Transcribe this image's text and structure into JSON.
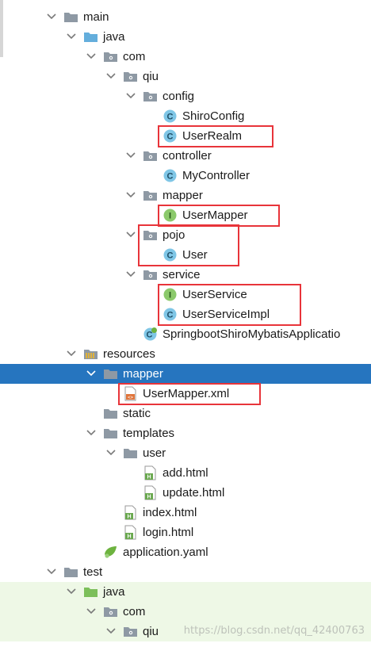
{
  "tree": [
    {
      "id": "main",
      "label": "main",
      "depth": 0,
      "kind": "folder-gray",
      "arrow": "expanded"
    },
    {
      "id": "java",
      "label": "java",
      "depth": 1,
      "kind": "folder-blue",
      "arrow": "expanded"
    },
    {
      "id": "com",
      "label": "com",
      "depth": 2,
      "kind": "package",
      "arrow": "expanded"
    },
    {
      "id": "qiu",
      "label": "qiu",
      "depth": 3,
      "kind": "package",
      "arrow": "expanded"
    },
    {
      "id": "config",
      "label": "config",
      "depth": 4,
      "kind": "package",
      "arrow": "expanded"
    },
    {
      "id": "shiroconfig",
      "label": "ShiroConfig",
      "depth": 5,
      "kind": "class"
    },
    {
      "id": "userrealm",
      "label": "UserRealm",
      "depth": 5,
      "kind": "class"
    },
    {
      "id": "controller",
      "label": "controller",
      "depth": 4,
      "kind": "package",
      "arrow": "expanded"
    },
    {
      "id": "mycontroller",
      "label": "MyController",
      "depth": 5,
      "kind": "class"
    },
    {
      "id": "mapper-pkg",
      "label": "mapper",
      "depth": 4,
      "kind": "package",
      "arrow": "expanded"
    },
    {
      "id": "usermapper",
      "label": "UserMapper",
      "depth": 5,
      "kind": "interface"
    },
    {
      "id": "pojo",
      "label": "pojo",
      "depth": 4,
      "kind": "package",
      "arrow": "expanded"
    },
    {
      "id": "user",
      "label": "User",
      "depth": 5,
      "kind": "class"
    },
    {
      "id": "service",
      "label": "service",
      "depth": 4,
      "kind": "package",
      "arrow": "expanded"
    },
    {
      "id": "userservice",
      "label": "UserService",
      "depth": 5,
      "kind": "interface"
    },
    {
      "id": "userserviceimpl",
      "label": "UserServiceImpl",
      "depth": 5,
      "kind": "class"
    },
    {
      "id": "springbootapp",
      "label": "SpringbootShiroMybatisApplicatio",
      "depth": 4,
      "kind": "spring-class"
    },
    {
      "id": "resources",
      "label": "resources",
      "depth": 1,
      "kind": "folder-resources",
      "arrow": "expanded"
    },
    {
      "id": "mapper-res",
      "label": "mapper",
      "depth": 2,
      "kind": "folder-gray",
      "arrow": "expanded",
      "selected": true
    },
    {
      "id": "usermapper-xml",
      "label": "UserMapper.xml",
      "depth": 3,
      "kind": "xml"
    },
    {
      "id": "static",
      "label": "static",
      "depth": 2,
      "kind": "folder-gray"
    },
    {
      "id": "templates",
      "label": "templates",
      "depth": 2,
      "kind": "folder-gray",
      "arrow": "expanded"
    },
    {
      "id": "user-dir",
      "label": "user",
      "depth": 3,
      "kind": "folder-gray",
      "arrow": "expanded"
    },
    {
      "id": "add-html",
      "label": "add.html",
      "depth": 4,
      "kind": "html"
    },
    {
      "id": "update-html",
      "label": "update.html",
      "depth": 4,
      "kind": "html"
    },
    {
      "id": "index-html",
      "label": "index.html",
      "depth": 3,
      "kind": "html"
    },
    {
      "id": "login-html",
      "label": "login.html",
      "depth": 3,
      "kind": "html"
    },
    {
      "id": "application-yaml",
      "label": "application.yaml",
      "depth": 2,
      "kind": "yaml"
    },
    {
      "id": "test",
      "label": "test",
      "depth": 0,
      "kind": "folder-gray",
      "arrow": "expanded"
    },
    {
      "id": "test-java",
      "label": "java",
      "depth": 1,
      "kind": "folder-green",
      "arrow": "expanded",
      "test_bg": true
    },
    {
      "id": "test-com",
      "label": "com",
      "depth": 2,
      "kind": "package",
      "arrow": "expanded",
      "test_bg": true
    },
    {
      "id": "test-qiu",
      "label": "qiu",
      "depth": 3,
      "kind": "package",
      "arrow": "expanded",
      "test_bg": true
    }
  ],
  "highlight_groups": [
    [
      "userrealm"
    ],
    [
      "usermapper"
    ],
    [
      "pojo",
      "user"
    ],
    [
      "userservice",
      "userserviceimpl"
    ],
    [
      "usermapper-xml"
    ]
  ],
  "watermark": "https://blog.csdn.net/qq_42400763",
  "colors": {
    "selection": "#2675bf",
    "highlight_box": "#e8343a",
    "test_background": "#eef8e6",
    "class_icon": "#7fc6e6",
    "interface_icon": "#8bc96b",
    "folder_gray": "#8e99a4",
    "folder_blue": "#64aedc",
    "folder_green": "#7cbf5a"
  }
}
